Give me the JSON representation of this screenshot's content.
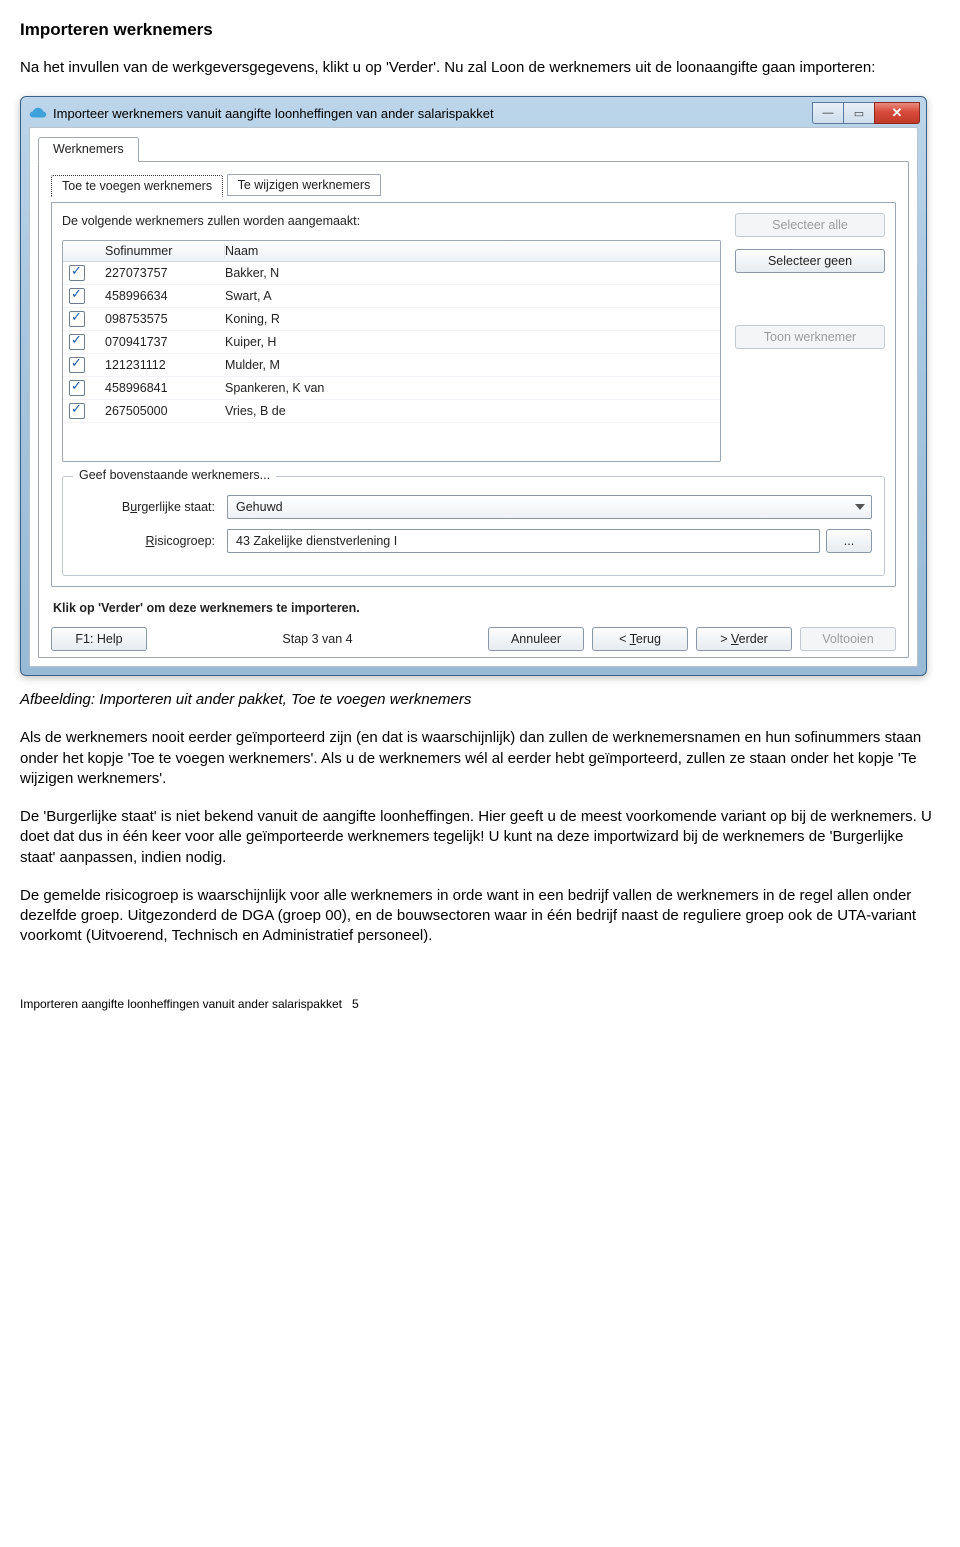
{
  "doc": {
    "heading": "Importeren werknemers",
    "intro": "Na het invullen van de werkgeversgegevens, klikt u op 'Verder'. Nu zal Loon de werknemers uit de loonaangifte gaan importeren:",
    "caption": "Afbeelding: Importeren uit ander pakket, Toe te voegen werknemers",
    "p1": "Als de werknemers nooit eerder geïmporteerd zijn (en dat is waarschijnlijk) dan zullen de werknemersnamen en hun sofinummers staan onder het kopje 'Toe te voegen werknemers'. Als u de werknemers wél al eerder hebt geïmporteerd, zullen ze staan onder het kopje 'Te wijzigen werknemers'.",
    "p2": "De 'Burgerlijke staat' is niet bekend vanuit de aangifte loonheffingen. Hier geeft u de meest voorkomende variant op bij de werknemers. U doet dat dus in één keer voor alle geïmporteerde werknemers tegelijk! U kunt na deze importwizard bij de werknemers de 'Burgerlijke staat' aanpassen, indien nodig.",
    "p3": "De gemelde risicogroep is waarschijnlijk voor alle werknemers in orde want in een bedrijf vallen de werknemers in de regel allen onder dezelfde groep. Uitgezonderd de DGA (groep 00), en de bouwsectoren waar in één bedrijf naast de reguliere groep ook de UTA-variant voorkomt (Uitvoerend, Technisch en Administratief personeel).",
    "footer_text": "Importeren aangifte loonheffingen vanuit ander salarispakket",
    "footer_page": "5"
  },
  "window": {
    "title": "Importeer werknemers vanuit aangifte loonheffingen van ander salarispakket",
    "tab_outer": "Werknemers",
    "subtab_active": "Toe te voegen werknemers",
    "subtab_other": "Te wijzigen werknemers",
    "intro_line": "De volgende werknemers zullen worden aangemaakt:",
    "col_sofi": "Sofinummer",
    "col_naam": "Naam",
    "rows": [
      {
        "sofi": "227073757",
        "naam": "Bakker, N"
      },
      {
        "sofi": "458996634",
        "naam": "Swart, A"
      },
      {
        "sofi": "098753575",
        "naam": "Koning, R"
      },
      {
        "sofi": "070941737",
        "naam": "Kuiper, H"
      },
      {
        "sofi": "121231112",
        "naam": "Mulder, M"
      },
      {
        "sofi": "458996841",
        "naam": "Spankeren, K van"
      },
      {
        "sofi": "267505000",
        "naam": "Vries, B de"
      }
    ],
    "btn_select_all": "Selecteer alle",
    "btn_select_none": "Selecteer geen",
    "btn_show_emp": "Toon werknemer",
    "group_legend": "Geef bovenstaande werknemers...",
    "label_burg_pre": "B",
    "label_burg_u": "u",
    "label_burg_post": "rgerlijke staat:",
    "value_burg": "Gehuwd",
    "label_risk_u": "R",
    "label_risk_post": "isicogroep:",
    "value_risk": "43 Zakelijke dienstverlening I",
    "bold_line": "Klik op 'Verder' om deze werknemers te importeren.",
    "btn_help": "F1: Help",
    "step_text": "Stap 3 van  4",
    "btn_cancel": "Annuleer",
    "btn_back_lt": "< ",
    "btn_back_u": "T",
    "btn_back_post": "erug",
    "btn_next_gt": "> ",
    "btn_next_u": "V",
    "btn_next_post": "erder",
    "btn_finish": "Voltooien"
  }
}
